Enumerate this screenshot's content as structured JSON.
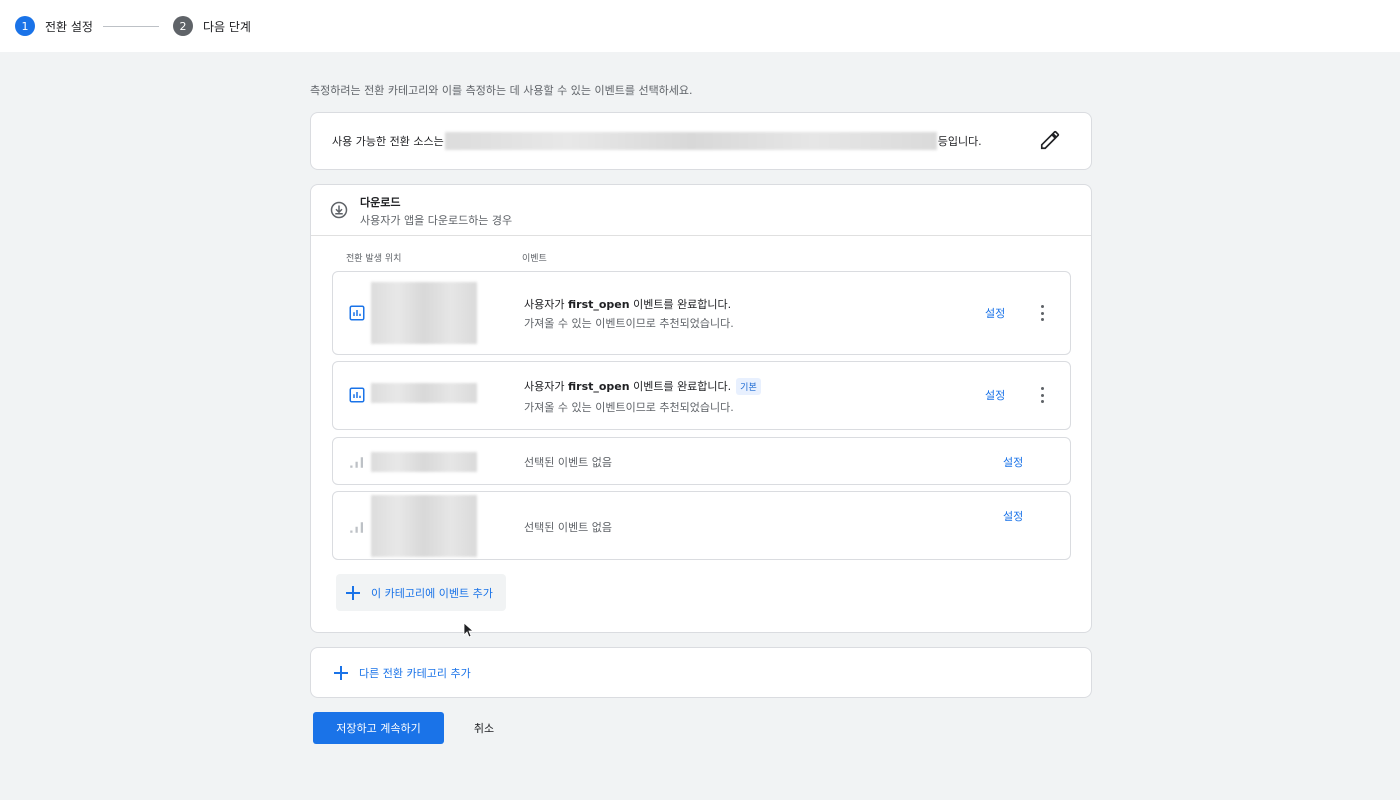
{
  "stepper": {
    "step1": {
      "number": "1",
      "label": "전환 설정"
    },
    "step2": {
      "number": "2",
      "label": "다음 단계"
    }
  },
  "intro": "측정하려는 전환 카테고리와 이를 측정하는 데 사용할 수 있는 이벤트를 선택하세요.",
  "source_card": {
    "prefix": "사용 가능한 전환 소스는",
    "suffix": "등입니다."
  },
  "download": {
    "title": "다운로드",
    "subtitle": "사용자가 앱을 다운로드하는 경우",
    "columns": {
      "location": "전환 발생 위치",
      "event": "이벤트"
    },
    "rows": [
      {
        "text_pre": "사용자가 ",
        "event_name": "first_open",
        "text_post": " 이벤트를 완료합니다.",
        "sub": "가져올 수 있는 이벤트이므로 추천되었습니다.",
        "action": "설정"
      },
      {
        "text_pre": "사용자가 ",
        "event_name": "first_open",
        "text_post": " 이벤트를 완료합니다.",
        "badge": "기본",
        "sub": "가져올 수 있는 이벤트이므로 추천되었습니다.",
        "action": "설정"
      },
      {
        "text": "선택된 이벤트 없음",
        "action": "설정"
      },
      {
        "text": "선택된 이벤트 없음",
        "action": "설정"
      }
    ],
    "add_event": "이 카테고리에 이벤트 추가"
  },
  "add_category": "다른 전환 카테고리 추가",
  "buttons": {
    "save": "저장하고 계속하기",
    "cancel": "취소"
  },
  "colors": {
    "accent": "#1a73e8",
    "text": "#202124",
    "muted": "#5f6368",
    "background": "#f1f3f4"
  }
}
